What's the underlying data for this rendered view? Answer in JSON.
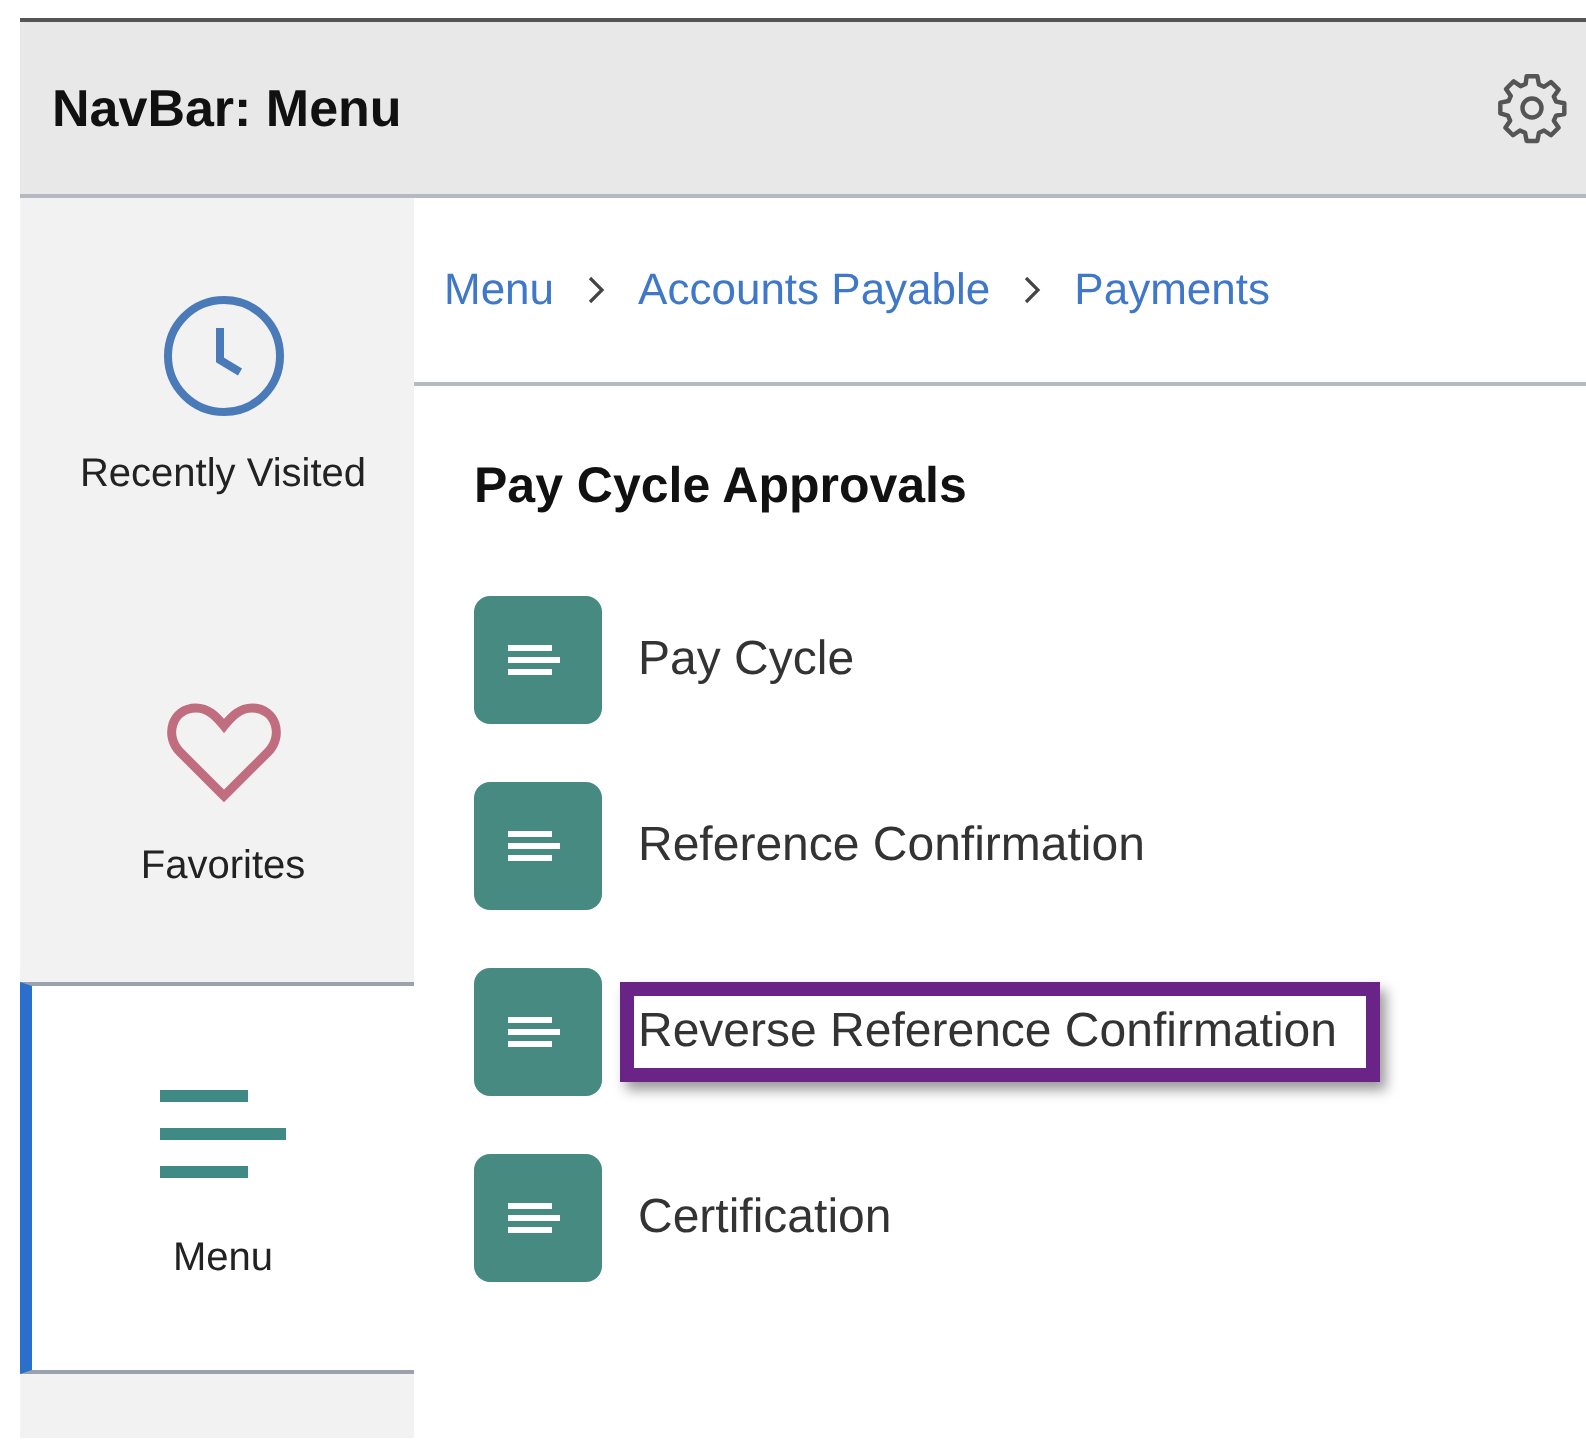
{
  "header": {
    "title": "NavBar: Menu"
  },
  "sidebar": {
    "items": [
      {
        "label": "Recently Visited",
        "kind": "clock",
        "selected": false
      },
      {
        "label": "Favorites",
        "kind": "heart",
        "selected": false
      },
      {
        "label": "Menu",
        "kind": "menu",
        "selected": true
      }
    ]
  },
  "breadcrumb": [
    "Menu",
    "Accounts Payable",
    "Payments"
  ],
  "section": {
    "title": "Pay Cycle Approvals",
    "items": [
      {
        "label": "Pay Cycle",
        "highlighted": false
      },
      {
        "label": "Reference Confirmation",
        "highlighted": false
      },
      {
        "label": "Reverse Reference Confirmation",
        "highlighted": true
      },
      {
        "label": "Certification",
        "highlighted": false
      }
    ]
  }
}
